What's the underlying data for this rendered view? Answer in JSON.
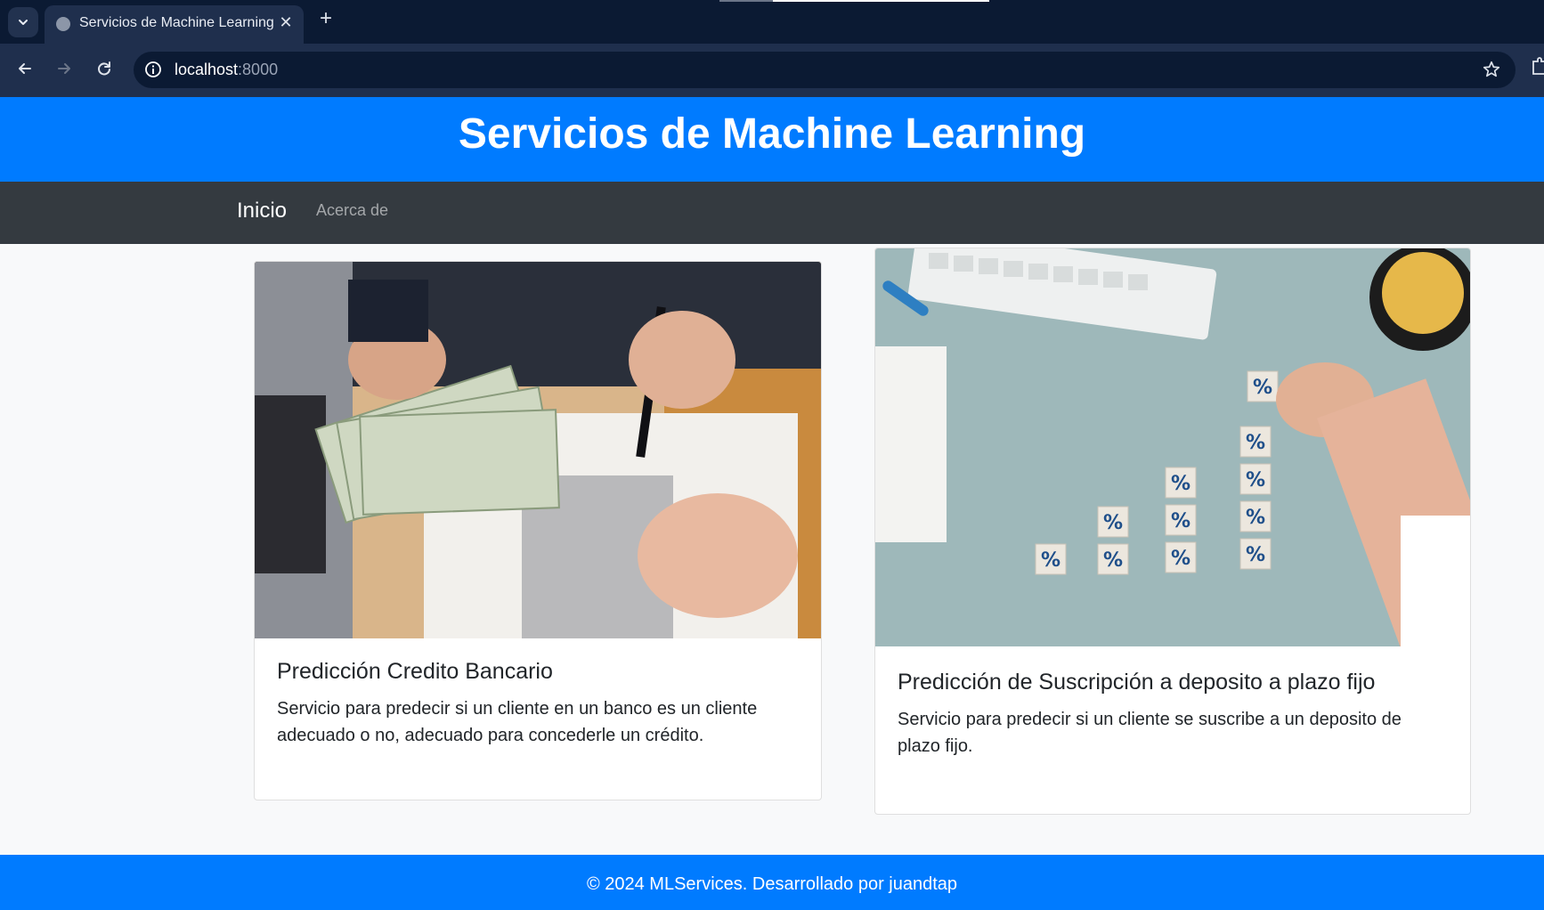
{
  "browser": {
    "tab_title": "Servicios de Machine Learning",
    "url_host": "localhost",
    "url_port": ":8000"
  },
  "header": {
    "title": "Servicios de Machine Learning"
  },
  "nav": {
    "items": [
      {
        "label": "Inicio",
        "active": true
      },
      {
        "label": "Acerca de",
        "active": false
      }
    ]
  },
  "services": [
    {
      "title": "Predicción Credito Bancario",
      "description": "Servicio para predecir si un cliente en un banco es un cliente adecuado o no, adecuado para concederle un crédito.",
      "image_subject": "money-handover-contract-photo"
    },
    {
      "title": "Predicción de Suscripción a deposito a plazo fijo",
      "description": "Servicio para predecir si un cliente se suscribe a un deposito de plazo fijo.",
      "image_subject": "percent-blocks-growth-photo"
    }
  ],
  "footer": {
    "text": "© 2024 MLServices. Desarrollado por juandtap"
  },
  "colors": {
    "primary": "#007bff",
    "navbar": "#343a40",
    "page_bg": "#f8f9fa"
  }
}
